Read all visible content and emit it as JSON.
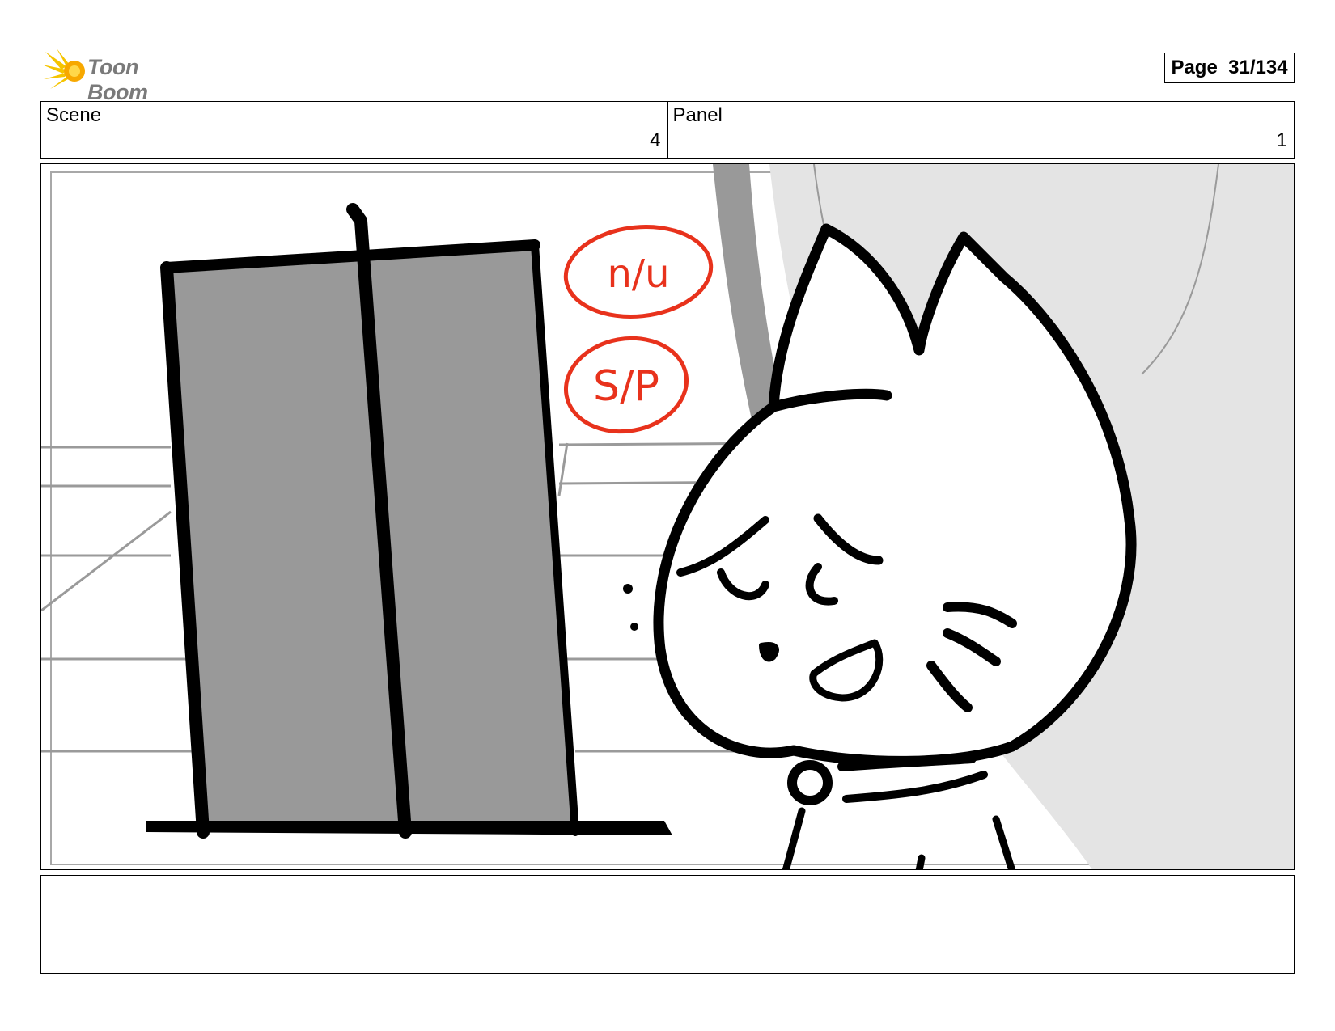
{
  "brand": {
    "logo_text": "Toon Boom",
    "logo_icon": "starburst-logo-icon"
  },
  "page": {
    "label": "Page  31/134"
  },
  "header": {
    "scene_label": "Scene",
    "scene_value": "4",
    "panel_label": "Panel",
    "panel_value": "1"
  },
  "panel": {
    "annotations": [
      "n/u",
      "S/P"
    ],
    "annotation_color": "#e8321c"
  },
  "notes": {
    "text": ""
  }
}
